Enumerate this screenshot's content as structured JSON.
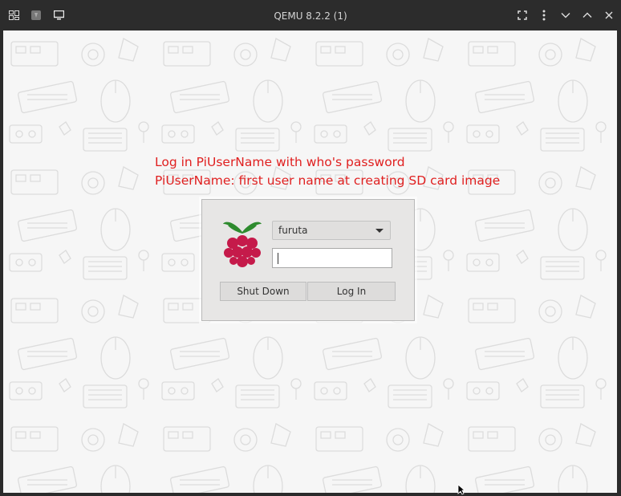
{
  "window": {
    "title": "QEMU 8.2.2 (1)"
  },
  "annotation": {
    "line1": "Log in PiUserName with who's password",
    "line2": "PiUserName: first user name at creating SD card image",
    "color": "#e02020"
  },
  "login": {
    "selected_user": "furuta",
    "password_value": "",
    "shutdown_label": "Shut Down",
    "login_label": "Log In"
  },
  "icons": {
    "titlebar_left": [
      "dashboard-icon",
      "keyboard-icon",
      "display-icon"
    ],
    "titlebar_right": [
      "fullscreen-icon",
      "menu-dots-icon",
      "minimize-icon",
      "maximize-icon",
      "close-icon"
    ],
    "logo": "raspberry-pi-logo"
  }
}
